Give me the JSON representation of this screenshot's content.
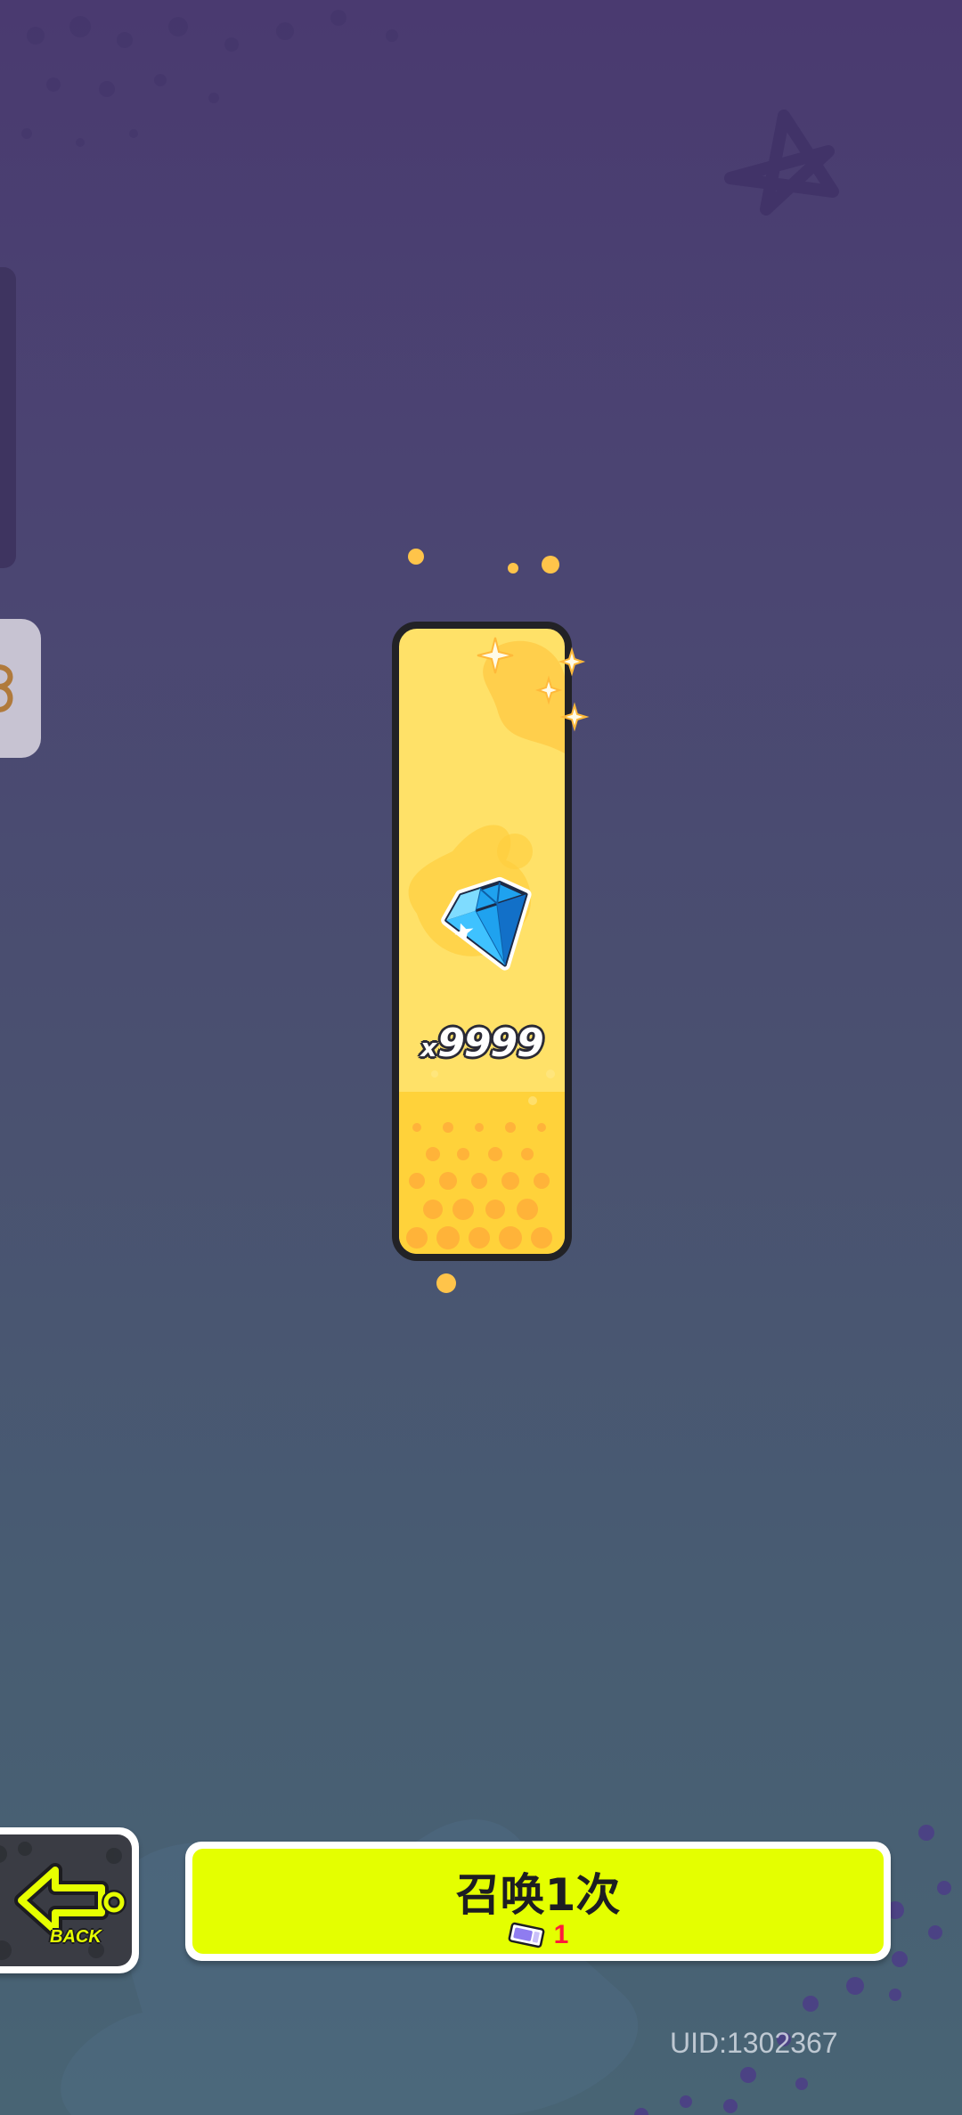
{
  "reward": {
    "item_icon": "blue-diamond-icon",
    "quantity_prefix": "x",
    "quantity": "9999"
  },
  "controls": {
    "back_label": "BACK",
    "back_icon": "back-arrow-icon",
    "summon_label": "召唤1次",
    "summon_cost_icon": "summon-ticket-icon",
    "summon_cost": "1"
  },
  "footer": {
    "uid": "UID:1302367"
  },
  "colors": {
    "summon_button": "#e4ff00",
    "cost_text": "#ff1a3c",
    "card": "#ffe168"
  }
}
